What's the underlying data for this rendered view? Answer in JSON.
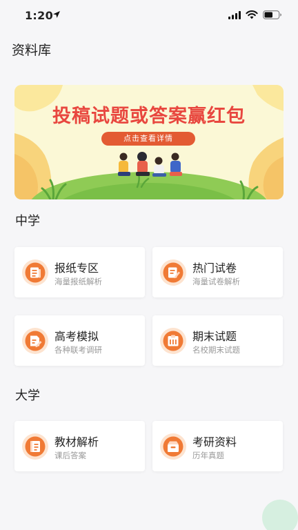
{
  "status_bar": {
    "time": "1:20"
  },
  "page_title": "资料库",
  "banner": {
    "title": "投稿试题或答案赢红包",
    "button_label": "点击查看详情"
  },
  "sections": [
    {
      "title": "中学",
      "cards": [
        {
          "title": "报纸专区",
          "subtitle": "海量报纸解析",
          "icon": "newspaper-icon"
        },
        {
          "title": "热门试卷",
          "subtitle": "海量试卷解析",
          "icon": "exam-paper-icon"
        },
        {
          "title": "高考模拟",
          "subtitle": "各种联考调研",
          "icon": "mock-exam-icon"
        },
        {
          "title": "期末试题",
          "subtitle": "名校期末试题",
          "icon": "final-exam-icon"
        }
      ]
    },
    {
      "title": "大学",
      "cards": [
        {
          "title": "教材解析",
          "subtitle": "课后答案",
          "icon": "textbook-icon"
        },
        {
          "title": "考研资料",
          "subtitle": "历年真题",
          "icon": "archive-box-icon"
        }
      ]
    }
  ],
  "colors": {
    "accent": "#f07a35",
    "banner_title": "#e8473f",
    "banner_button": "#e35b33",
    "background": "#f6f6f8"
  }
}
